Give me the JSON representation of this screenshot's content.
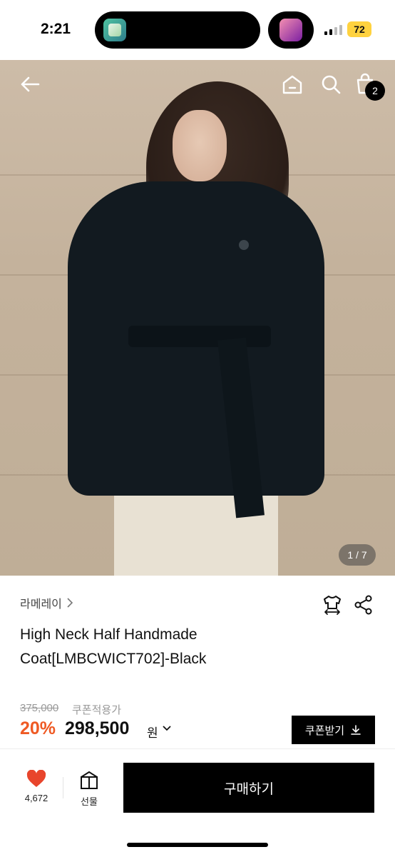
{
  "status_bar": {
    "time": "2:21",
    "battery": "72",
    "battery_color": "#ffd23f"
  },
  "nav": {
    "cart_count": "2",
    "icons": [
      "back-arrow-icon",
      "home-icon",
      "search-icon",
      "shopping-bag-icon"
    ]
  },
  "gallery": {
    "counter": "1 / 7"
  },
  "product": {
    "brand": "라메레이",
    "title_line1": "High Neck Half Handmade",
    "title_line2": "Coat[LMBCWICT702]-Black",
    "original_price": "375,000",
    "price_note": "쿠폰적용가",
    "discount": "20%",
    "sale_price": "298,500",
    "currency": "원",
    "discount_color": "#ef5a24"
  },
  "actions": {
    "coupon_label": "쿠폰받기",
    "like_count": "4,672",
    "gift_label": "선물",
    "buy_label": "구매하기",
    "like_color": "#e8452c"
  }
}
